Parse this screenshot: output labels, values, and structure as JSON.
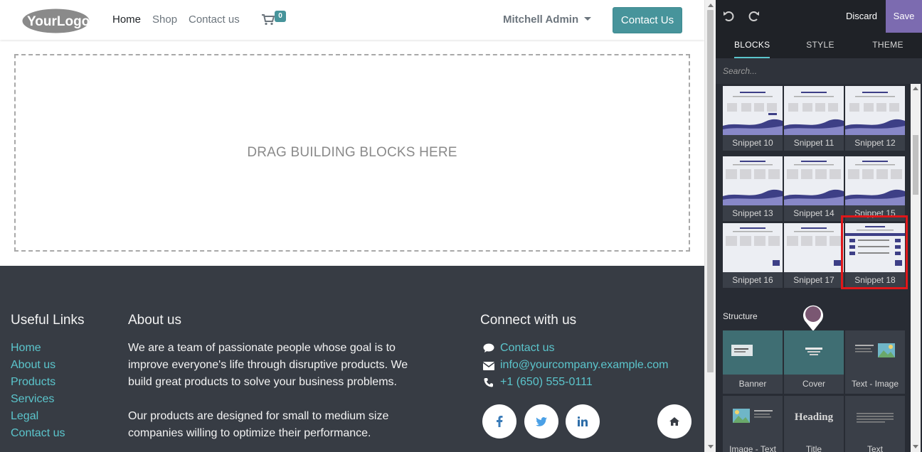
{
  "nav": {
    "logo_text": "YourLogo",
    "links": [
      "Home",
      "Shop",
      "Contact us"
    ],
    "cart_count": "0",
    "user_name": "Mitchell Admin",
    "cta_label": "Contact Us"
  },
  "dropzone": {
    "text": "DRAG BUILDING BLOCKS HERE"
  },
  "footer": {
    "useful_links": {
      "title": "Useful Links",
      "items": [
        "Home",
        "About us",
        "Products",
        "Services",
        "Legal",
        "Contact us"
      ]
    },
    "about": {
      "title": "About us",
      "paragraph1": "We are a team of passionate people whose goal is to improve everyone's life through disruptive products. We build great products to solve your business problems.",
      "paragraph2": "Our products are designed for small to medium size companies willing to optimize their performance."
    },
    "connect": {
      "title": "Connect with us",
      "contact_label": "Contact us",
      "email": "info@yourcompany.example.com",
      "phone": "+1 (650) 555-0111"
    },
    "social_icons": [
      "facebook-icon",
      "twitter-icon",
      "linkedin-icon",
      "home-icon"
    ]
  },
  "editor": {
    "discard_label": "Discard",
    "save_label": "Save",
    "tabs": [
      "BLOCKS",
      "STYLE",
      "THEME"
    ],
    "active_tab": "BLOCKS",
    "search_placeholder": "Search...",
    "snippets": [
      "Snippet 10",
      "Snippet 11",
      "Snippet 12",
      "Snippet 13",
      "Snippet 14",
      "Snippet 15",
      "Snippet 16",
      "Snippet 17",
      "Snippet 18"
    ],
    "highlighted_snippet": "Snippet 18",
    "structure_title": "Structure",
    "structure_blocks": [
      "Banner",
      "Cover",
      "Text - Image",
      "Image - Text",
      "Title",
      "Text"
    ],
    "title_block_heading": "Heading"
  },
  "colors": {
    "accent": "#47949b",
    "link": "#5bc5cc",
    "footer_bg": "#373c44",
    "editor_bg": "#282c34",
    "save_bg": "#7c6bb0",
    "highlight": "#e0171a"
  }
}
